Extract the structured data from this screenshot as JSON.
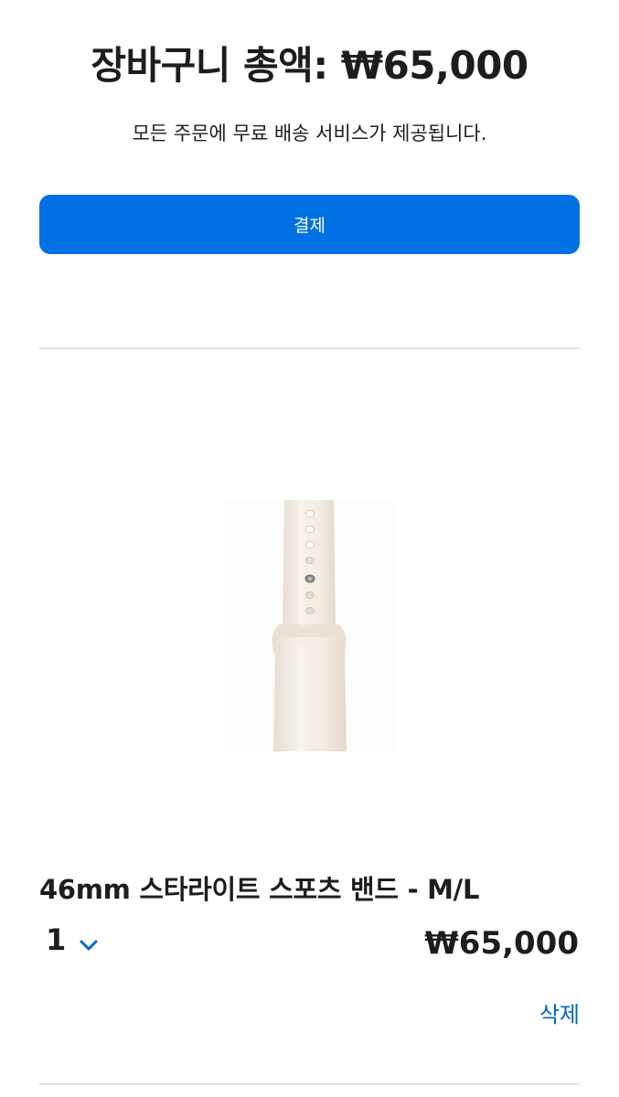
{
  "summary": {
    "title": "장바구니 총액: ₩65,000",
    "subtitle": "모든 주문에 무료 배송 서비스가 제공됩니다.",
    "checkout_label": "결제"
  },
  "cart_item": {
    "name": "46mm 스타라이트 스포츠 밴드 - M/L",
    "quantity": "1",
    "price": "₩65,000",
    "remove_label": "삭제",
    "image_icon": "watch-band-image",
    "quantity_icon": "chevron-down-icon"
  },
  "colors": {
    "accent": "#0071e3",
    "link": "#0066cc",
    "text": "#1d1d1f",
    "divider": "#e0e0e2",
    "band": "#f3ece4"
  }
}
